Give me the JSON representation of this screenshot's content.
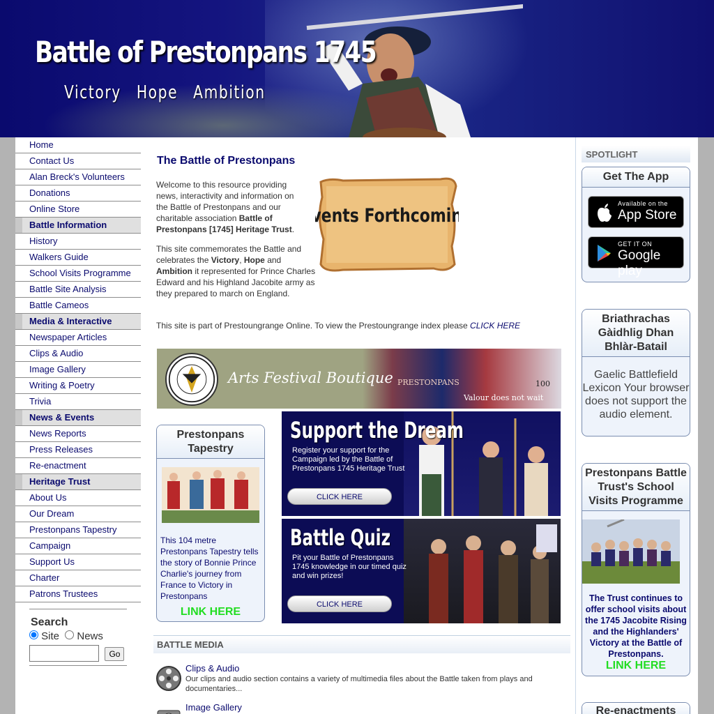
{
  "header": {
    "title": "Battle of Prestonpans 1745",
    "tagline": "Victory   Hope   Ambition"
  },
  "nav": {
    "items": [
      {
        "label": "Home",
        "section": false
      },
      {
        "label": "Contact Us",
        "section": false
      },
      {
        "label": "Alan Breck's Volunteers",
        "section": false
      },
      {
        "label": "Donations",
        "section": false
      },
      {
        "label": "Online Store",
        "section": false
      },
      {
        "label": "Battle Information",
        "section": true
      },
      {
        "label": "History",
        "section": false
      },
      {
        "label": "Walkers Guide",
        "section": false
      },
      {
        "label": "School Visits Programme",
        "section": false
      },
      {
        "label": "Battle Site Analysis",
        "section": false
      },
      {
        "label": "Battle Cameos",
        "section": false
      },
      {
        "label": "Media & Interactive",
        "section": true
      },
      {
        "label": "Newspaper Articles",
        "section": false
      },
      {
        "label": "Clips & Audio",
        "section": false
      },
      {
        "label": "Image Gallery",
        "section": false
      },
      {
        "label": "Writing & Poetry",
        "section": false
      },
      {
        "label": "Trivia",
        "section": false
      },
      {
        "label": "News & Events",
        "section": true
      },
      {
        "label": "News Reports",
        "section": false
      },
      {
        "label": "Press Releases",
        "section": false
      },
      {
        "label": "Re-enactment",
        "section": false
      },
      {
        "label": "Heritage Trust",
        "section": true
      },
      {
        "label": "About Us",
        "section": false
      },
      {
        "label": "Our Dream",
        "section": false
      },
      {
        "label": "Prestonpans Tapestry",
        "section": false
      },
      {
        "label": "Campaign",
        "section": false
      },
      {
        "label": "Support Us",
        "section": false
      },
      {
        "label": "Charter",
        "section": false
      },
      {
        "label": "Patrons Trustees",
        "section": false
      }
    ]
  },
  "search": {
    "heading": "Search",
    "option_site": "Site",
    "option_news": "News",
    "selected": "Site",
    "input_value": "",
    "go_label": "Go"
  },
  "main": {
    "title": "The Battle of Prestonpans",
    "intro1_a": "Welcome to this resource providing news, interactivity and information on the Battle of Prestonpans and our charitable association ",
    "intro1_b": "Battle of Prestonpans [1745] Heritage Trust",
    "intro1_c": ".",
    "intro2_a": "This site commemorates the Battle and celebrates the ",
    "intro2_victory": "Victory",
    "intro2_comma": ", ",
    "intro2_hope": "Hope",
    "intro2_and": " and ",
    "intro2_ambition": "Ambition",
    "intro2_b": " it represented for Prince Charles Edward and his Highland Jacobite army as they prepared to march on England.",
    "intro3_a": "This site is part of Prestoungrange Online. To view the Prestoungrange index please ",
    "intro3_link": "CLICK HERE",
    "scroll_label": "Events Forthcoming"
  },
  "boutique": {
    "title": "Arts Festival Boutique",
    "logo_text": "PRESTOUNGRANGE ARTS FESTIVAL SOCIETY",
    "book_title": "PRESTONPANS",
    "slogan": "Valour does not wait",
    "number": "100"
  },
  "tapestry": {
    "title": "Prestonpans Tapestry",
    "text": "This 104 metre Prestonpans Tapestry tells the story of Bonnie Prince Charlie's journey from France to Victory in Prestonpans",
    "link": "LINK HERE"
  },
  "support": {
    "title": "Support the Dream",
    "text": "Register your support for the Campaign led by the Battle of Prestonpans 1745 Heritage Trust",
    "button": "CLICK HERE"
  },
  "quiz": {
    "title": "Battle Quiz",
    "text": "Pit your Battle of Prestonpans 1745 knowledge in our timed quiz and win prizes!",
    "button": "CLICK HERE"
  },
  "media": {
    "heading": "BATTLE MEDIA",
    "items": [
      {
        "title": "Clips & Audio",
        "desc": "Our clips and audio section contains a variety of multimedia files about the Battle taken from plays and documentaries..."
      },
      {
        "title": "Image Gallery",
        "desc": ""
      }
    ]
  },
  "sidebar": {
    "spotlight": "SPOTLIGHT",
    "app": {
      "title": "Get The App",
      "appstore_small": "Available on the",
      "appstore_big": "App Store",
      "play_small": "GET IT ON",
      "play_big": "Google play"
    },
    "gaelic": {
      "title": "Briathrachas Gàidhlig Dhan Bhlàr-Batail",
      "text": "Gaelic Battlefield Lexicon Your browser does not support the audio element."
    },
    "school": {
      "title": "Prestonpans Battle Trust's School Visits Programme",
      "text": "The Trust continues to offer school visits about the 1745 Jacobite Rising and the Highlanders' Victory at the Battle of Prestonpans.",
      "link": "LINK HERE"
    },
    "reenact": {
      "title": "Re-enactments"
    }
  },
  "colors": {
    "header_bg": "#0a0a6e",
    "nav_text": "#0a0a6e",
    "link_green": "#22dd22",
    "banner_bg": "#0c0c55"
  }
}
